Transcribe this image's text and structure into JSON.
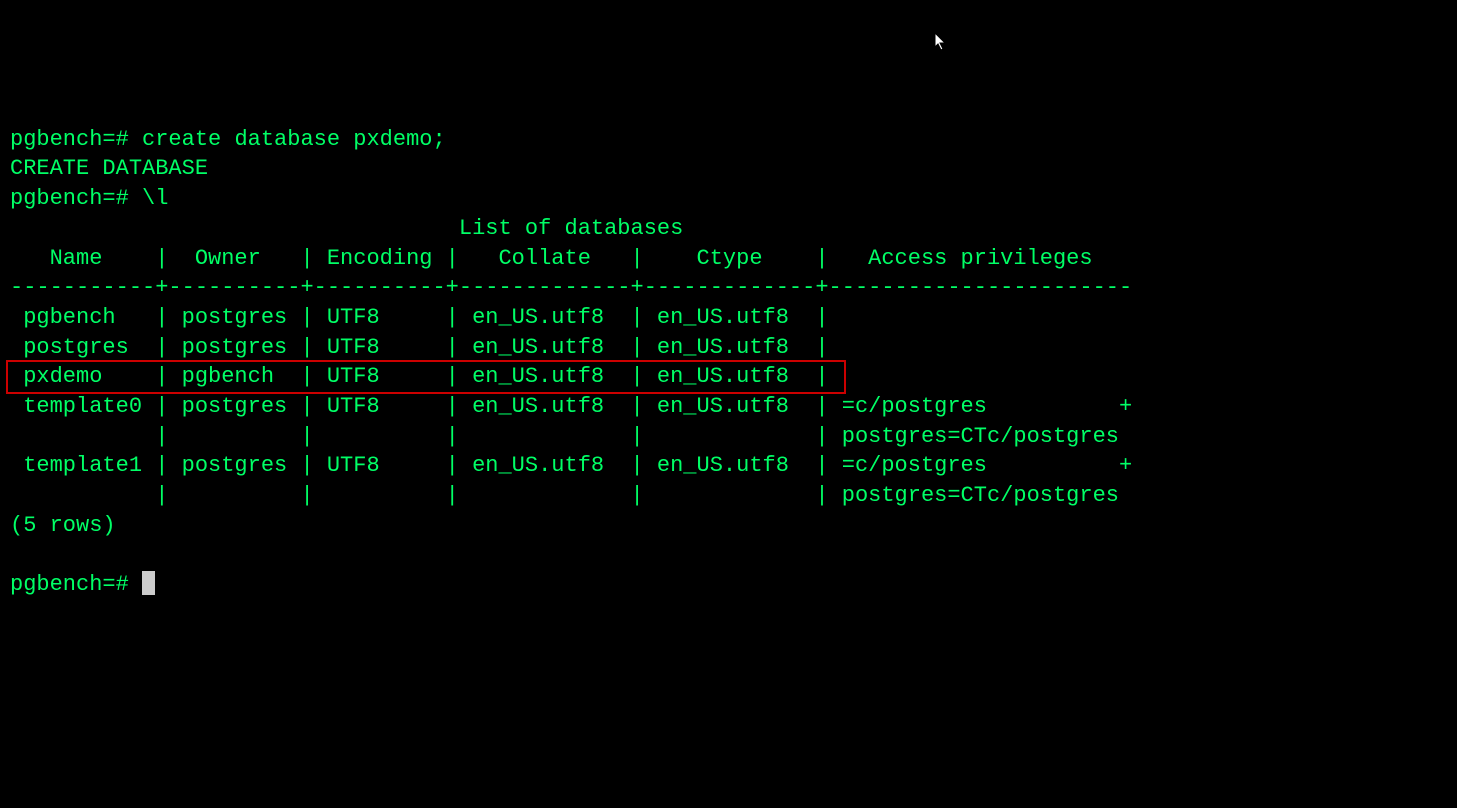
{
  "terminal": {
    "line1_prompt": "pgbench=# ",
    "line1_cmd": "create database pxdemo;",
    "line2": "CREATE DATABASE",
    "line3_prompt": "pgbench=# ",
    "line3_cmd": "\\l",
    "table_title": "                                  List of databases",
    "header": "   Name    |  Owner   | Encoding |   Collate   |    Ctype    |   Access privileges   ",
    "divider": "-----------+----------+----------+-------------+-------------+-----------------------",
    "row1": " pgbench   | postgres | UTF8     | en_US.utf8  | en_US.utf8  | ",
    "row2": " postgres  | postgres | UTF8     | en_US.utf8  | en_US.utf8  | ",
    "row3": " pxdemo    | pgbench  | UTF8     | en_US.utf8  | en_US.utf8  | ",
    "row4": " template0 | postgres | UTF8     | en_US.utf8  | en_US.utf8  | =c/postgres          +",
    "row4b": "           |          |          |             |             | postgres=CTc/postgres",
    "row5": " template1 | postgres | UTF8     | en_US.utf8  | en_US.utf8  | =c/postgres          +",
    "row5b": "           |          |          |             |             | postgres=CTc/postgres",
    "rowcount": "(5 rows)",
    "blank": "",
    "final_prompt": "pgbench=# "
  }
}
